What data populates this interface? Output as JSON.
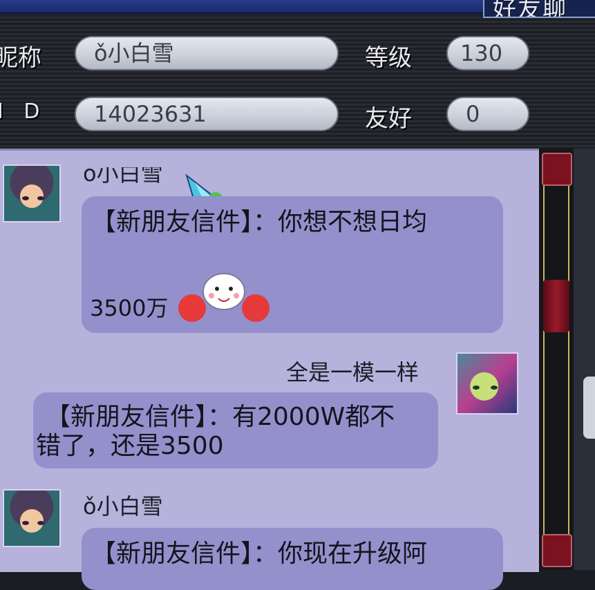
{
  "window": {
    "title": "好友聊"
  },
  "profile": {
    "nickname_label": "昵称",
    "nickname_value": "ǒ小白雪",
    "level_label": "等级",
    "level_value": "130",
    "id_label": "I D",
    "id_value": "14023631",
    "friendship_label": "友好",
    "friendship_value": "0"
  },
  "messages": [
    {
      "sender": "ǒ小白雪",
      "text": "【新朋友信件】：你想不想日均",
      "text2": "3500万"
    },
    {
      "sender": "全是一模一样",
      "text": "【新朋友信件】：有2000W都不",
      "text2": "错了，还是3500"
    },
    {
      "sender": "ǒ小白雪",
      "text": "【新朋友信件】：你现在升级阿"
    }
  ],
  "icons": [
    "crystal-sticker-icon",
    "cheerleader-emoji-icon",
    "scroll-up-icon",
    "scroll-down-icon"
  ],
  "colors": {
    "chat_bg": "#b6b2dc",
    "bubble": "#9490cc",
    "scroll_button": "#7a1220"
  }
}
